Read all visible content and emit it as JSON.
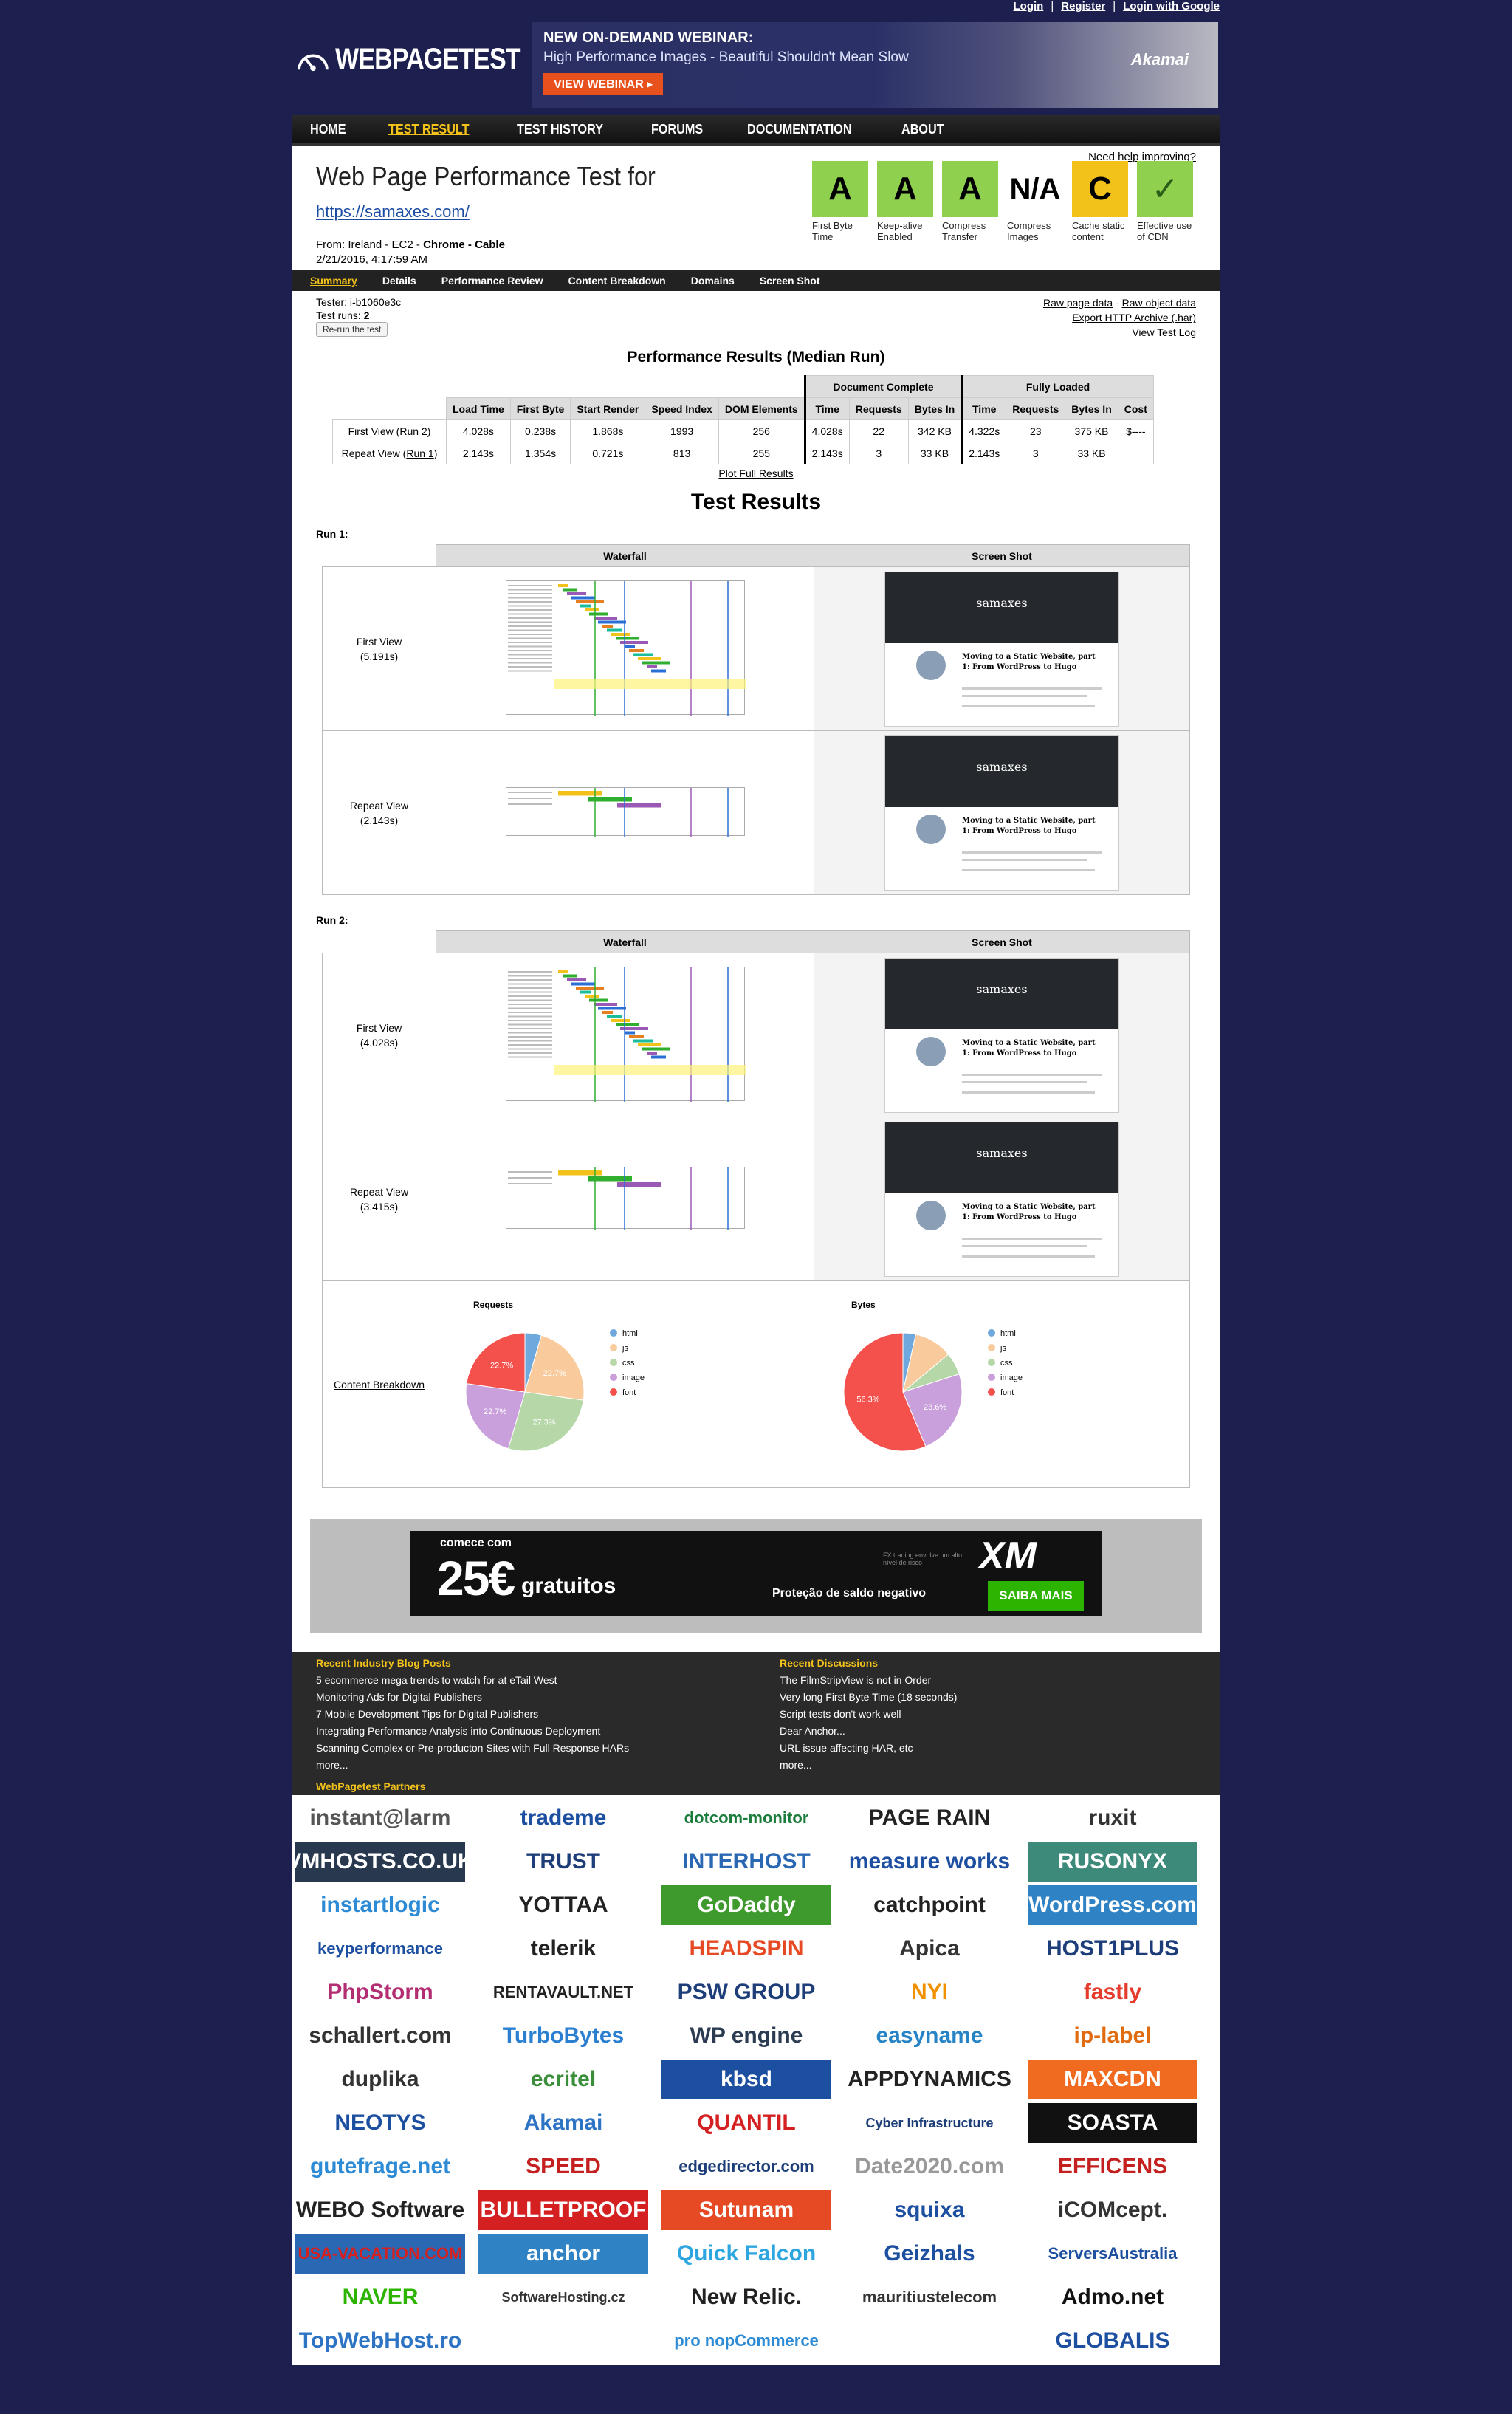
{
  "auth": {
    "login": "Login",
    "register": "Register",
    "login_google": "Login with Google"
  },
  "brand": {
    "name": "WEBPAGETEST"
  },
  "banner": {
    "line1": "NEW ON-DEMAND WEBINAR:",
    "line2": "High Performance Images - Beautiful Shouldn't Mean Slow",
    "cta": "VIEW WEBINAR ▸",
    "sponsor": "Akamai"
  },
  "nav": [
    "HOME",
    "TEST RESULT",
    "TEST HISTORY",
    "FORUMS",
    "DOCUMENTATION",
    "ABOUT"
  ],
  "test": {
    "title": "Web Page Performance Test for",
    "url": "https://samaxes.com/",
    "from_label": "From:",
    "from": "Ireland - EC2 -",
    "browser": "Chrome - Cable",
    "date": "2/21/2016, 4:17:59 AM",
    "help": "Need help improving?"
  },
  "grades": [
    {
      "grade": "A",
      "label": "First Byte Time",
      "color": "#8fd14f"
    },
    {
      "grade": "A",
      "label": "Keep-alive Enabled",
      "color": "#8fd14f"
    },
    {
      "grade": "A",
      "label": "Compress Transfer",
      "color": "#8fd14f"
    },
    {
      "grade": "N/A",
      "label": "Compress Images",
      "color": "#ffffff"
    },
    {
      "grade": "C",
      "label": "Cache static content",
      "color": "#f2c21a"
    },
    {
      "grade": "✓",
      "label": "Effective use of CDN",
      "color": "#8fd14f"
    }
  ],
  "tabs": [
    "Summary",
    "Details",
    "Performance Review",
    "Content Breakdown",
    "Domains",
    "Screen Shot"
  ],
  "summary": {
    "tester": "Tester: i-b1060e3c",
    "runs_label": "Test runs:",
    "runs": "2",
    "rerun": "Re-run the test",
    "raw_page": "Raw page data",
    "raw_object": "Raw object data",
    "export": "Export HTTP Archive (.har)",
    "view_log": "View Test Log"
  },
  "perf": {
    "title": "Performance Results (Median Run)",
    "group_doc": "Document Complete",
    "group_full": "Fully Loaded",
    "headers": [
      "Load Time",
      "First Byte",
      "Start Render",
      "Speed Index",
      "DOM Elements",
      "Time",
      "Requests",
      "Bytes In",
      "Time",
      "Requests",
      "Bytes In",
      "Cost"
    ],
    "rows": [
      {
        "label": "First View",
        "run": "Run 2",
        "cells": [
          "4.028s",
          "0.238s",
          "1.868s",
          "1993",
          "256",
          "4.028s",
          "22",
          "342 KB",
          "4.322s",
          "23",
          "375 KB",
          "$----"
        ]
      },
      {
        "label": "Repeat View",
        "run": "Run 1",
        "cells": [
          "2.143s",
          "1.354s",
          "0.721s",
          "813",
          "255",
          "2.143s",
          "3",
          "33 KB",
          "2.143s",
          "3",
          "33 KB",
          ""
        ]
      }
    ],
    "plot": "Plot Full Results"
  },
  "results": {
    "title": "Test Results",
    "col_waterfall": "Waterfall",
    "col_screenshot": "Screen Shot",
    "run1": "Run 1:",
    "run2": "Run 2:",
    "r1_first": "First View",
    "r1_first_time": "(5.191s)",
    "r1_repeat": "Repeat View",
    "r1_repeat_time": "(2.143s)",
    "r2_first": "First View",
    "r2_first_time": "(4.028s)",
    "r2_repeat": "Repeat View",
    "r2_repeat_time": "(3.415s)",
    "breakdown": "Content Breakdown",
    "ss_site": "samaxes",
    "ss_heading": "Moving to a Static Website, part 1: From WordPress to Hugo"
  },
  "chart_data": [
    {
      "type": "pie",
      "title": "Requests",
      "categories": [
        "html",
        "js",
        "css",
        "image",
        "font"
      ],
      "values": [
        4.5,
        22.7,
        27.3,
        22.7,
        22.7
      ],
      "colors": [
        "#6fa8dc",
        "#f9cb9c",
        "#b6d7a8",
        "#c9a0dc",
        "#f4514c"
      ]
    },
    {
      "type": "pie",
      "title": "Bytes",
      "categories": [
        "html",
        "js",
        "css",
        "image",
        "font"
      ],
      "values": [
        3.5,
        10.5,
        6.1,
        23.6,
        56.3
      ],
      "colors": [
        "#6fa8dc",
        "#f9cb9c",
        "#b6d7a8",
        "#c9a0dc",
        "#f4514c"
      ]
    }
  ],
  "ad": {
    "line1": "comece com",
    "big": "25€",
    "word": "gratuitos",
    "fx": "FX trading envolve um alto nível de risco",
    "brand": "XM",
    "note": "Proteção de saldo negativo",
    "cta": "SAIBA MAIS"
  },
  "blog": {
    "title": "Recent Industry Blog Posts",
    "items": [
      "5 ecommerce mega trends to watch for at eTail West",
      "Monitoring Ads for Digital Publishers",
      "7 Mobile Development Tips for Digital Publishers",
      "Integrating Performance Analysis into Continuous Deployment",
      "Scanning Complex or Pre-producton Sites with Full Response HARs",
      "more..."
    ]
  },
  "discussions": {
    "title": "Recent Discussions",
    "items": [
      "The FilmStripView is not in Order",
      "Very long First Byte Time (18 seconds)",
      "Script tests don't work well",
      "Dear Anchor...",
      "URL issue affecting HAR, etc",
      "more..."
    ]
  },
  "partners_title": "WebPagetest Partners",
  "partners": [
    {
      "name": "instant@larm",
      "color": "#555555",
      "bg": "#ffffff"
    },
    {
      "name": "trademe",
      "color": "#1d4fa0",
      "bg": "#ffffff"
    },
    {
      "name": "dotcom-monitor",
      "color": "#1b7c3c",
      "bg": "#ffffff"
    },
    {
      "name": "PAGE RAIN",
      "color": "#222222",
      "bg": "#ffffff"
    },
    {
      "name": "ruxit",
      "color": "#333333",
      "bg": "#ffffff"
    },
    {
      "name": "VMHOSTS.CO.UK",
      "color": "#ffffff",
      "bg": "#27384f"
    },
    {
      "name": "TRUST",
      "color": "#1d3e78",
      "bg": "#ffffff"
    },
    {
      "name": "INTERHOST",
      "color": "#2a68b3",
      "bg": "#ffffff"
    },
    {
      "name": "measure works",
      "color": "#1f4fa0",
      "bg": "#ffffff"
    },
    {
      "name": "RUSONYX",
      "color": "#ffffff",
      "bg": "#3d8a7a"
    },
    {
      "name": "instartlogic",
      "color": "#2d8bd6",
      "bg": "#ffffff"
    },
    {
      "name": "YOTTAA",
      "color": "#222222",
      "bg": "#ffffff"
    },
    {
      "name": "GoDaddy",
      "color": "#ffffff",
      "bg": "#3e9a2c"
    },
    {
      "name": "catchpoint",
      "color": "#222222",
      "bg": "#ffffff"
    },
    {
      "name": "WordPress.com",
      "color": "#ffffff",
      "bg": "#2f82c4"
    },
    {
      "name": "keyperformance",
      "color": "#1d4fa0",
      "bg": "#ffffff"
    },
    {
      "name": "telerik",
      "color": "#222222",
      "bg": "#ffffff"
    },
    {
      "name": "HEADSPIN",
      "color": "#e54a25",
      "bg": "#ffffff"
    },
    {
      "name": "Apica",
      "color": "#333333",
      "bg": "#ffffff"
    },
    {
      "name": "HOST1PLUS",
      "color": "#1d3e78",
      "bg": "#ffffff"
    },
    {
      "name": "PhpStorm",
      "color": "#b32d73",
      "bg": "#ffffff"
    },
    {
      "name": "RENTAVAULT.NET",
      "color": "#222222",
      "bg": "#ffffff"
    },
    {
      "name": "PSW GROUP",
      "color": "#1d3e78",
      "bg": "#ffffff"
    },
    {
      "name": "NYI",
      "color": "#f29100",
      "bg": "#ffffff"
    },
    {
      "name": "fastly",
      "color": "#e53b2c",
      "bg": "#ffffff"
    },
    {
      "name": "schallert.com",
      "color": "#333333",
      "bg": "#ffffff"
    },
    {
      "name": "TurboBytes",
      "color": "#2a7fd0",
      "bg": "#ffffff"
    },
    {
      "name": "WP engine",
      "color": "#2a3b52",
      "bg": "#ffffff"
    },
    {
      "name": "easyname",
      "color": "#2683c6",
      "bg": "#ffffff"
    },
    {
      "name": "ip-label",
      "color": "#e06b10",
      "bg": "#ffffff"
    },
    {
      "name": "duplika",
      "color": "#333333",
      "bg": "#ffffff"
    },
    {
      "name": "ecritel",
      "color": "#3b8f3b",
      "bg": "#ffffff"
    },
    {
      "name": "kbsd",
      "color": "#ffffff",
      "bg": "#1d4fa0"
    },
    {
      "name": "APPDYNAMICS",
      "color": "#222222",
      "bg": "#ffffff"
    },
    {
      "name": "MAXCDN",
      "color": "#ffffff",
      "bg": "#f06a20"
    },
    {
      "name": "NEOTYS",
      "color": "#1d4fa0",
      "bg": "#ffffff"
    },
    {
      "name": "Akamai",
      "color": "#2d74c4",
      "bg": "#ffffff"
    },
    {
      "name": "QUANTIL",
      "color": "#d42020",
      "bg": "#ffffff"
    },
    {
      "name": "Cyber Infrastructure",
      "color": "#1d3e78",
      "bg": "#ffffff"
    },
    {
      "name": "SOASTA",
      "color": "#ffffff",
      "bg": "#111111"
    },
    {
      "name": "gutefrage.net",
      "color": "#2d8bd6",
      "bg": "#ffffff"
    },
    {
      "name": "SPEED",
      "color": "#c42020",
      "bg": "#ffffff"
    },
    {
      "name": "edgedirector.com",
      "color": "#1d3e78",
      "bg": "#ffffff"
    },
    {
      "name": "Date2020.com",
      "color": "#999999",
      "bg": "#ffffff"
    },
    {
      "name": "EFFICENS",
      "color": "#c42020",
      "bg": "#ffffff"
    },
    {
      "name": "WEBO Software",
      "color": "#222222",
      "bg": "#ffffff"
    },
    {
      "name": "BULLETPROOF",
      "color": "#ffffff",
      "bg": "#d42020"
    },
    {
      "name": "Sutunam",
      "color": "#ffffff",
      "bg": "#e54a25"
    },
    {
      "name": "squixa",
      "color": "#1d4fa0",
      "bg": "#ffffff"
    },
    {
      "name": "iCOMcept.",
      "color": "#333333",
      "bg": "#ffffff"
    },
    {
      "name": "USA-VACATION.COM",
      "color": "#d42020",
      "bg": "#2a68b3"
    },
    {
      "name": "anchor",
      "color": "#ffffff",
      "bg": "#2f82c4"
    },
    {
      "name": "Quick Falcon",
      "color": "#2da6e0",
      "bg": "#ffffff"
    },
    {
      "name": "Geizhals",
      "color": "#1d4fa0",
      "bg": "#ffffff"
    },
    {
      "name": "ServersAustralia",
      "color": "#1d4fa0",
      "bg": "#ffffff"
    },
    {
      "name": "NAVER",
      "color": "#2db400",
      "bg": "#ffffff"
    },
    {
      "name": "SoftwareHosting.cz",
      "color": "#333333",
      "bg": "#ffffff"
    },
    {
      "name": "New Relic.",
      "color": "#222222",
      "bg": "#ffffff"
    },
    {
      "name": "mauritiustelecom",
      "color": "#333333",
      "bg": "#ffffff"
    },
    {
      "name": "Admo.net",
      "color": "#111111",
      "bg": "#ffffff"
    },
    {
      "name": "TopWebHost.ro",
      "color": "#2d74c4",
      "bg": "#ffffff"
    },
    {
      "name": "",
      "color": "#ffffff",
      "bg": "#ffffff"
    },
    {
      "name": "pro nopCommerce",
      "color": "#2d8bd6",
      "bg": "#ffffff"
    },
    {
      "name": "",
      "color": "#ffffff",
      "bg": "#ffffff"
    },
    {
      "name": "GLOBALIS",
      "color": "#1d4fa0",
      "bg": "#ffffff"
    }
  ]
}
